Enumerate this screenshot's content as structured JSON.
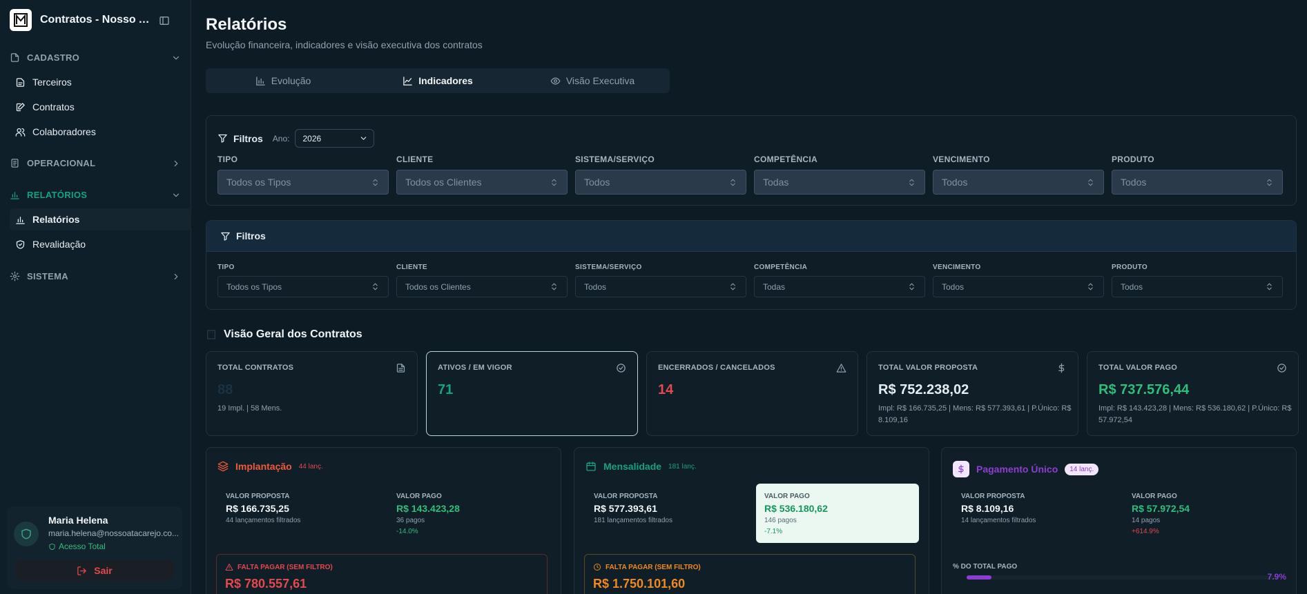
{
  "app": {
    "title": "Contratos - Nosso Ata..."
  },
  "sidebar": {
    "cadastro": {
      "label": "CADASTRO",
      "items": [
        "Terceiros",
        "Contratos",
        "Colaboradores"
      ]
    },
    "operacional": {
      "label": "OPERACIONAL"
    },
    "relatorios": {
      "label": "RELATÓRIOS",
      "items": [
        "Relatórios",
        "Revalidação"
      ]
    },
    "sistema": {
      "label": "SISTEMA"
    },
    "active_item": "Relatórios"
  },
  "user": {
    "name": "Maria Helena",
    "email": "maria.helena@nossoatacarejo.co...",
    "access": "Acesso Total",
    "logout": "Sair"
  },
  "page": {
    "title": "Relatórios",
    "subtitle": "Evolução financeira, indicadores e visão executiva dos contratos"
  },
  "tabs": [
    {
      "label": "Evolução",
      "icon": "bar-chart-icon"
    },
    {
      "label": "Indicadores",
      "icon": "line-chart-icon",
      "active": true
    },
    {
      "label": "Visão Executiva",
      "icon": "eye-icon"
    }
  ],
  "filters_top": {
    "title": "Filtros",
    "year_label": "Ano:",
    "year": "2026",
    "fields": [
      {
        "label": "TIPO",
        "value": "Todos os Tipos"
      },
      {
        "label": "CLIENTE",
        "value": "Todos os Clientes"
      },
      {
        "label": "SISTEMA/SERVIÇO",
        "value": "Todos"
      },
      {
        "label": "COMPETÊNCIA",
        "value": "Todas"
      },
      {
        "label": "VENCIMENTO",
        "value": "Todos"
      },
      {
        "label": "PRODUTO",
        "value": "Todos"
      }
    ]
  },
  "filters_bottom": {
    "title": "Filtros",
    "fields": [
      {
        "label": "TIPO",
        "value": "Todos os Tipos"
      },
      {
        "label": "CLIENTE",
        "value": "Todos os Clientes"
      },
      {
        "label": "SISTEMA/SERVIÇO",
        "value": "Todos"
      },
      {
        "label": "COMPETÊNCIA",
        "value": "Todas"
      },
      {
        "label": "VENCIMENTO",
        "value": "Todos"
      },
      {
        "label": "PRODUTO",
        "value": "Todos"
      }
    ]
  },
  "overview": {
    "title": "Visão Geral dos Contratos",
    "kpis": [
      {
        "label": "TOTAL CONTRATOS",
        "value": "88",
        "sub": "19 Impl. | 58 Mens.",
        "icon": "file-icon",
        "color": "#1b3340"
      },
      {
        "label": "ATIVOS / EM VIGOR",
        "value": "71",
        "sub": "",
        "icon": "check-circle-icon",
        "color": "#14a37f"
      },
      {
        "label": "ENCERRADOS / CANCELADOS",
        "value": "14",
        "sub": "",
        "icon": "alert-triangle-icon",
        "color": "#e5484d"
      },
      {
        "label": "TOTAL VALOR PROPOSTA",
        "value": "R$ 752.238,02",
        "sub": "Impl: R$ 166.735,25 | Mens: R$ 577.393,61 | P.Único: R$ 8.109,16",
        "icon": "dollar-icon",
        "color": "#e6edf2"
      },
      {
        "label": "TOTAL VALOR PAGO",
        "value": "R$ 737.576,44",
        "sub": "Impl: R$ 143.423,28 | Mens: R$ 536.180,62 | P.Único: R$ 57.972,54",
        "icon": "check-circle-icon",
        "color": "#2fbf7a"
      }
    ]
  },
  "sections": {
    "implantacao": {
      "title": "Implantação",
      "badge": "44 lanç.",
      "color": "#e5484d",
      "title_color": "#f05a3a",
      "proposta_label": "VALOR PROPOSTA",
      "proposta": "R$ 166.735,25",
      "proposta_sub": "44 lançamentos filtrados",
      "pago_label": "VALOR PAGO",
      "pago": "R$ 143.423,28",
      "pago_sub": "36 pagos",
      "pago_pct": "-14.0%",
      "falta_label": "FALTA PAGAR (SEM FILTRO)",
      "falta": "R$ 780.557,61"
    },
    "mensalidade": {
      "title": "Mensalidade",
      "badge": "181 lanç.",
      "color": "#14a37f",
      "proposta_label": "VALOR PROPOSTA",
      "proposta": "R$ 577.393,61",
      "proposta_sub": "181 lançamentos filtrados",
      "pago_label": "VALOR PAGO",
      "pago": "R$ 536.180,62",
      "pago_sub": "146 pagos",
      "pago_pct": "-7.1%",
      "falta_label": "FALTA PAGAR (SEM FILTRO)",
      "falta": "R$ 1.750.101,60"
    },
    "pagamento_unico": {
      "title": "Pagamento Único",
      "badge": "14 lanç.",
      "color": "#8b3fd1",
      "proposta_label": "VALOR PROPOSTA",
      "proposta": "R$ 8.109,16",
      "proposta_sub": "14 lançamentos filtrados",
      "pago_label": "VALOR PAGO",
      "pago": "R$ 57.972,54",
      "pago_sub": "14 pagos",
      "pago_pct": "+614.9%",
      "pct_label": "% DO TOTAL PAGO",
      "pct_value": "7.9%",
      "pct_fraction": 0.079
    }
  }
}
